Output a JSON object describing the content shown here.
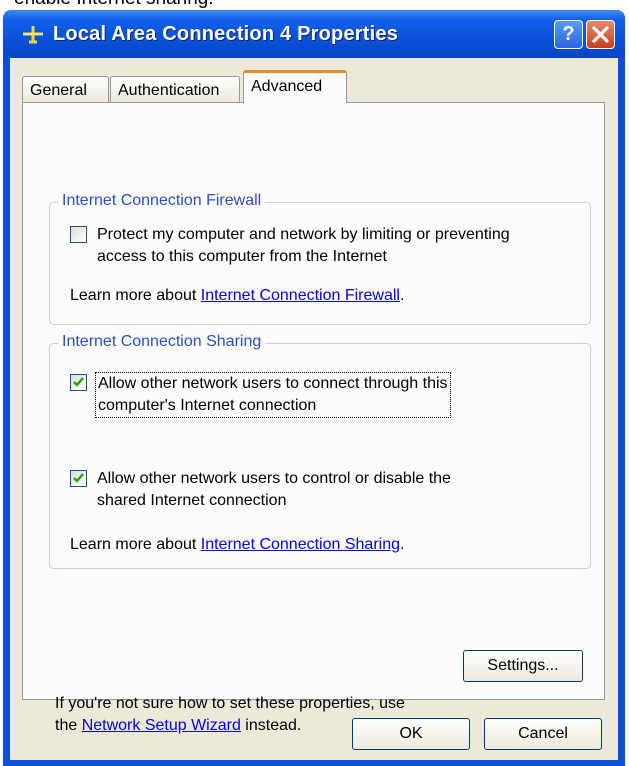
{
  "caption_fragment": "enable Internet sharing.",
  "window": {
    "title": "Local Area Connection 4 Properties",
    "help_label": "?"
  },
  "tabs": [
    {
      "label": "General"
    },
    {
      "label": "Authentication"
    },
    {
      "label": "Advanced"
    }
  ],
  "firewall": {
    "title": "Internet Connection Firewall",
    "protect_label_line1": "Protect my computer and network by limiting or preventing",
    "protect_label_line2": "access to this computer from the Internet",
    "protect_checked": false,
    "learn_prefix": "Learn more about ",
    "learn_link": "Internet Connection Firewall",
    "learn_suffix": "."
  },
  "sharing": {
    "title": "Internet Connection Sharing",
    "allow_connect_line1": "Allow other network users to connect through this",
    "allow_connect_line2": "computer's Internet connection",
    "allow_connect_checked": true,
    "allow_control_line1": "Allow other network users to control or disable the",
    "allow_control_line2": "shared Internet connection",
    "allow_control_checked": true,
    "learn_prefix": "Learn more about ",
    "learn_link": "Internet Connection Sharing",
    "learn_suffix": "."
  },
  "footer": {
    "hint_line1": "If you're not sure how to set these properties, use",
    "hint_prefix": "the ",
    "hint_link": "Network Setup Wizard",
    "hint_suffix": " instead.",
    "settings_label": "Settings...",
    "ok_label": "OK",
    "cancel_label": "Cancel"
  },
  "colors": {
    "titlebar": "#0a52d9",
    "client": "#ece9d8",
    "group_title": "#2c4dbd",
    "active_tab_accent": "#e68b2c",
    "check_mark": "#21a121"
  }
}
